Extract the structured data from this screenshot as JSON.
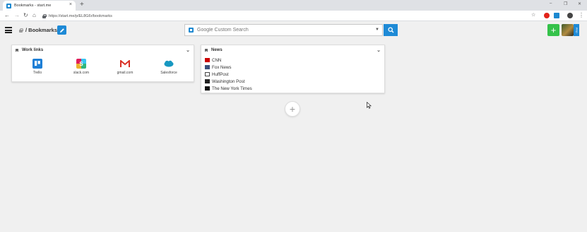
{
  "browser": {
    "tab_title": "Bookmarks - start.me",
    "tab_close": "×",
    "new_tab": "+",
    "url": "https://start.me/p/EL8G6r/bookmarks",
    "window_controls": [
      "–",
      "❐",
      "✕"
    ],
    "menu": "⋮"
  },
  "header": {
    "title": "/ Bookmarks",
    "search_placeholder": "Google Custom Search",
    "add_label": "+",
    "pro_label": "PRO"
  },
  "widgets": {
    "work_links": {
      "title": "Work links",
      "items": [
        {
          "label": "Trello",
          "icon": "trello-icon",
          "color": "#1e7fd6"
        },
        {
          "label": "slack.com",
          "icon": "slack-icon",
          "color": "#e01e5a"
        },
        {
          "label": "gmail.com",
          "icon": "gmail-icon",
          "color": "#d93025"
        },
        {
          "label": "Salesforce",
          "icon": "salesforce-icon",
          "color": "#1798c1"
        }
      ]
    },
    "news": {
      "title": "News",
      "items": [
        {
          "label": "CNN",
          "icon": "cnn-icon",
          "color": "#cc0000"
        },
        {
          "label": "Fox News",
          "icon": "fox-news-icon",
          "color": "#3b4f7a"
        },
        {
          "label": "HuffPost",
          "icon": "huffpost-icon",
          "color": "#444444"
        },
        {
          "label": "Washington Post",
          "icon": "washington-post-icon",
          "color": "#222222"
        },
        {
          "label": "The New York Times",
          "icon": "nyt-icon",
          "color": "#111111"
        }
      ]
    }
  },
  "add_widget_label": "+",
  "colors": {
    "accent": "#1e8ad6",
    "add_button": "#35c24a",
    "background": "#f0f0f0"
  }
}
